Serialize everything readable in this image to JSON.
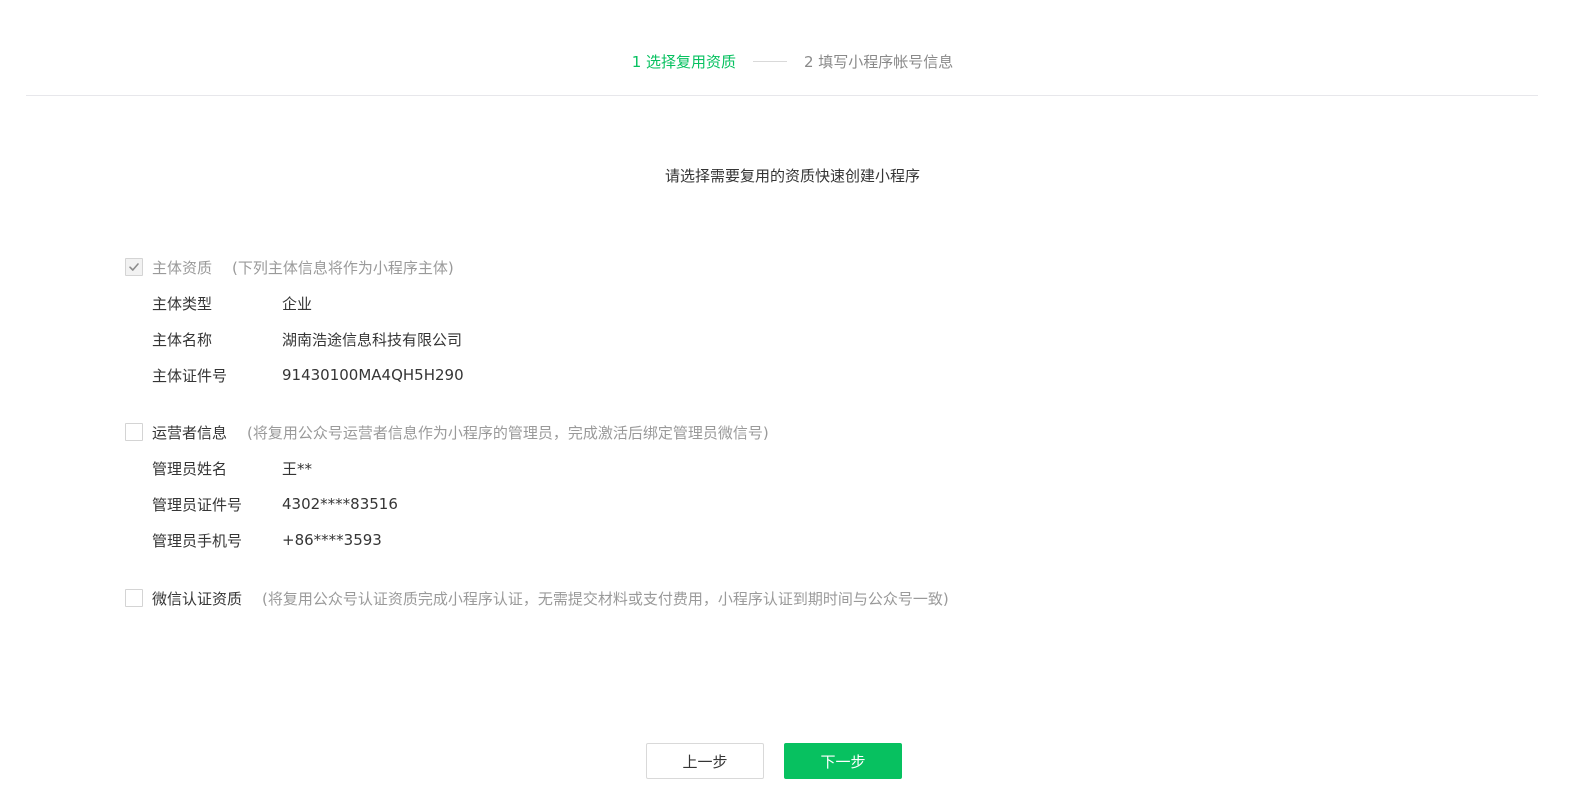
{
  "stepper": {
    "step1": "1 选择复用资质",
    "step2": "2 填写小程序帐号信息"
  },
  "subtitle": "请选择需要复用的资质快速创建小程序",
  "sections": {
    "entity": {
      "title": "主体资质",
      "note": "(下列主体信息将作为小程序主体)",
      "checked": true,
      "disabled": true,
      "rows": [
        {
          "label": "主体类型",
          "value": "企业"
        },
        {
          "label": "主体名称",
          "value": "湖南浩途信息科技有限公司"
        },
        {
          "label": "主体证件号",
          "value": "91430100MA4QH5H290"
        }
      ]
    },
    "operator": {
      "title": "运营者信息",
      "note": "(将复用公众号运营者信息作为小程序的管理员，完成激活后绑定管理员微信号)",
      "checked": false,
      "rows": [
        {
          "label": "管理员姓名",
          "value": "王**"
        },
        {
          "label": "管理员证件号",
          "value": "4302****83516"
        },
        {
          "label": "管理员手机号",
          "value": "+86****3593"
        }
      ]
    },
    "wechat_cert": {
      "title": "微信认证资质",
      "note": "(将复用公众号认证资质完成小程序认证，无需提交材料或支付费用，小程序认证到期时间与公众号一致)",
      "checked": false
    }
  },
  "buttons": {
    "prev": "上一步",
    "next": "下一步"
  },
  "colors": {
    "accent": "#07c160",
    "text": "#353535",
    "muted": "#9a9a9a"
  }
}
